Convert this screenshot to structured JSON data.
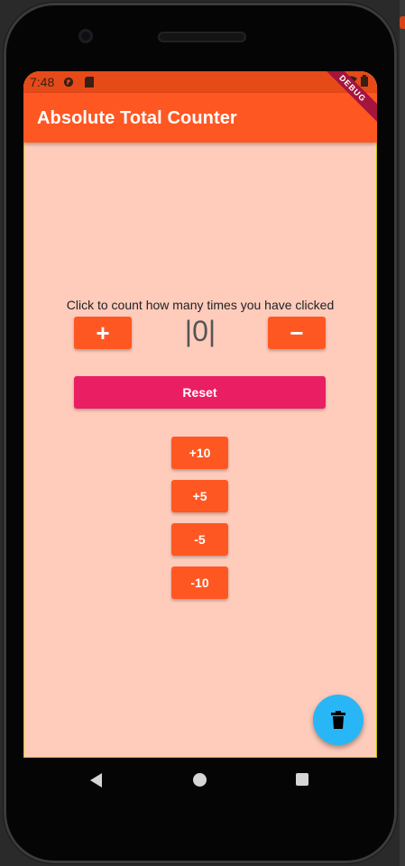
{
  "status_bar": {
    "time": "7:48"
  },
  "app_bar": {
    "title": "Absolute Total Counter",
    "debug_label": "DEBUG"
  },
  "counter": {
    "instruction": "Click to count how many times you have clicked",
    "plus_label": "+",
    "minus_label": "−",
    "value_display": "|0|"
  },
  "buttons": {
    "reset_label": "Reset",
    "plus_ten_label": "+10",
    "plus_five_label": "+5",
    "minus_five_label": "-5",
    "minus_ten_label": "-10"
  },
  "fab": {
    "icon": "trash-icon"
  },
  "colors": {
    "app_bar": "#ff5722",
    "status_bar": "#e64a19",
    "background": "#ffccbc",
    "reset": "#e91e63",
    "fab": "#29b6f6"
  }
}
